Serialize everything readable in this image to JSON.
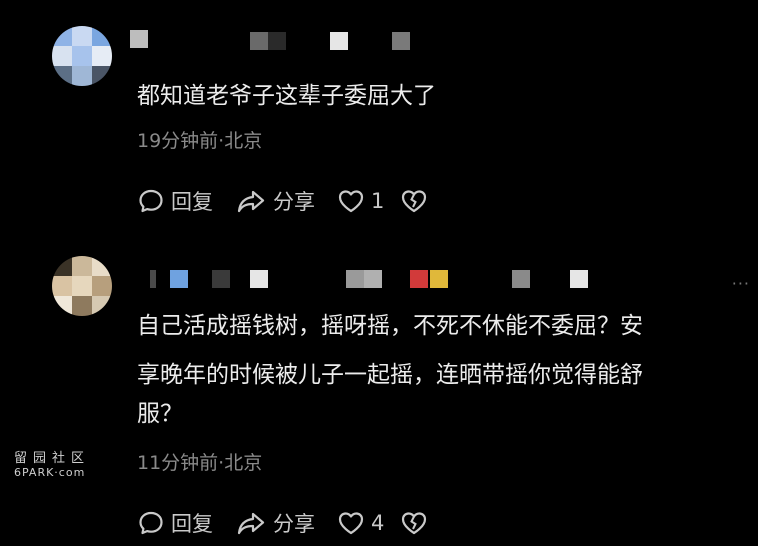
{
  "comments": [
    {
      "text": "都知道老爷子这辈子委屈大了",
      "meta": "19分钟前·北京",
      "reply_label": "回复",
      "share_label": "分享",
      "like_count": "1"
    },
    {
      "text_line1": "自己活成摇钱树，摇呀摇，不死不休能不委屈？安",
      "text_line2": "享晚年的时候被儿子一起摇，连晒带摇你觉得能舒",
      "text_line3": "服？",
      "meta": "11分钟前·北京",
      "reply_label": "回复",
      "share_label": "分享",
      "like_count": "4",
      "more_label": "···"
    }
  ],
  "watermark": {
    "cn": "留园社区",
    "en": "6PARK·com"
  },
  "colors": {
    "background": "#000000",
    "text": "#ececec",
    "meta": "#8a8a8a",
    "icon": "#c9c9c9"
  }
}
